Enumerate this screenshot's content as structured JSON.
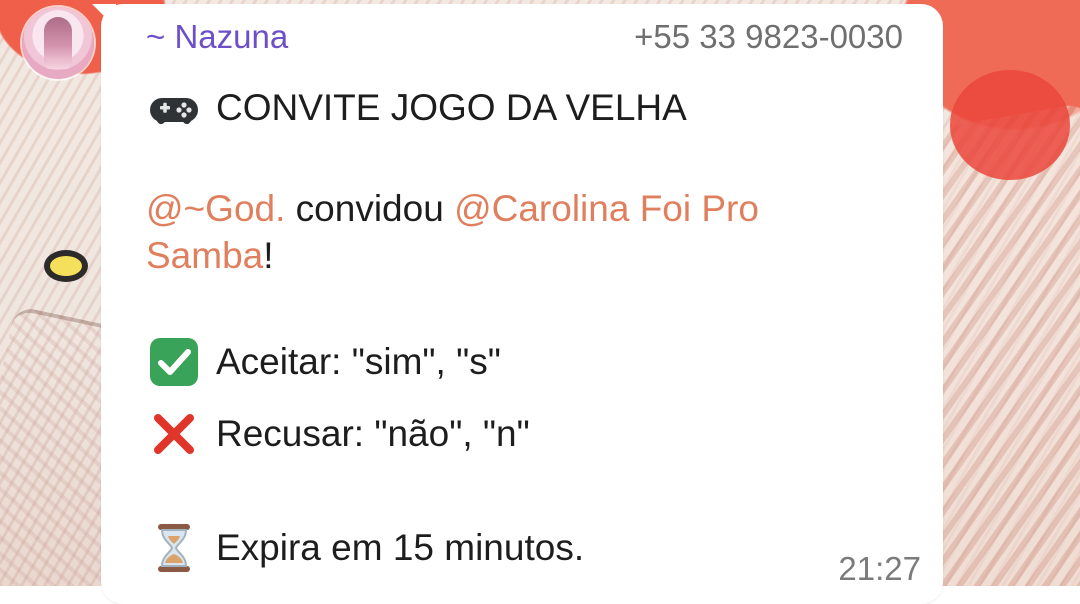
{
  "message": {
    "sender": {
      "name": "~ Nazuna",
      "phone": "+55 33 9823-0030"
    },
    "title": {
      "icon": "game-controller-icon",
      "text": "CONVITE JOGO DA VELHA"
    },
    "invite": {
      "inviter_mention": "@~God.",
      "verb": " convidou ",
      "invitee_mention": "@Carolina Foi Pro Samba",
      "end": "!"
    },
    "accept": {
      "icon": "check-mark-icon",
      "text": "Aceitar: \"sim\", \"s\""
    },
    "decline": {
      "icon": "cross-mark-icon",
      "text": "Recusar: \"não\", \"n\""
    },
    "expire": {
      "icon": "hourglass-icon",
      "text": "Expira em 15 minutos."
    },
    "time": "21:27"
  },
  "colors": {
    "sender_name": "#6d4fc8",
    "mention": "#e07f5d",
    "bubble": "#ffffff",
    "accept_icon": "#3aa35a",
    "decline_icon": "#e0352b"
  }
}
